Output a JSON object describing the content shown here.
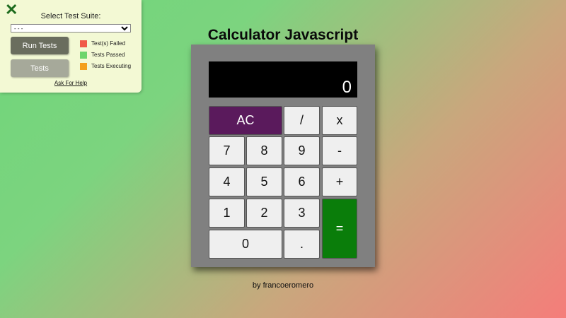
{
  "test_panel": {
    "close_symbol": "✕",
    "suite_label": "Select Test Suite:",
    "suite_selected": "- - -",
    "run_button": "Run Tests",
    "tests_button": "Tests",
    "legend": [
      {
        "label": "Test(s) Failed",
        "color": "#f05a47"
      },
      {
        "label": "Tests Passed",
        "color": "#6cd56c"
      },
      {
        "label": "Tests Executing",
        "color": "#f4a01c"
      }
    ],
    "help_link": "Ask For Help"
  },
  "calculator": {
    "title": "Calculator Javascript",
    "display": "0",
    "keys": {
      "clear": "AC",
      "divide": "/",
      "multiply": "x",
      "seven": "7",
      "eight": "8",
      "nine": "9",
      "subtract": "-",
      "four": "4",
      "five": "5",
      "six": "6",
      "add": "+",
      "one": "1",
      "two": "2",
      "three": "3",
      "equals": "=",
      "zero": "0",
      "decimal": "."
    },
    "colors": {
      "clear": "#5a1a5c",
      "equals": "#0a7d0a",
      "body": "#808080"
    }
  },
  "footer": {
    "author": "by francoeromero"
  }
}
